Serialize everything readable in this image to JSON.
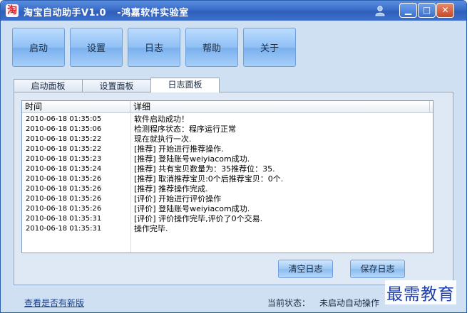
{
  "window": {
    "title": "淘宝自动助手V1.0   -鸿嘉软件实验室",
    "app_icon_glyph": "淘",
    "minimize_glyph": "▁",
    "maximize_glyph": "□",
    "close_glyph": "✕"
  },
  "toolbar": {
    "buttons": [
      {
        "label": "启动"
      },
      {
        "label": "设置"
      },
      {
        "label": "日志"
      },
      {
        "label": "帮助"
      },
      {
        "label": "关于"
      }
    ]
  },
  "tabs": [
    {
      "label": "启动面板",
      "active": false
    },
    {
      "label": "设置面板",
      "active": false
    },
    {
      "label": "日志面板",
      "active": true
    }
  ],
  "log": {
    "columns": [
      "时间",
      "详细"
    ],
    "rows": [
      {
        "time": "2010-06-18 01:35:05",
        "detail": "软件启动成功！"
      },
      {
        "time": "2010-06-18 01:35:06",
        "detail": "检测程序状态：程序运行正常"
      },
      {
        "time": "2010-06-18 01:35:22",
        "detail": "现在就执行一次."
      },
      {
        "time": "2010-06-18 01:35:22",
        "detail": "[推荐] 开始进行推荐操作."
      },
      {
        "time": "2010-06-18 01:35:23",
        "detail": "[推荐] 登陆账号weiyiacom成功."
      },
      {
        "time": "2010-06-18 01:35:24",
        "detail": "[推荐] 共有宝贝数量为：35推荐位：35."
      },
      {
        "time": "2010-06-18 01:35:26",
        "detail": "[推荐] 取消推荐宝贝:0个后推荐宝贝：0个."
      },
      {
        "time": "2010-06-18 01:35:26",
        "detail": "[推荐] 推荐操作完成."
      },
      {
        "time": "2010-06-18 01:35:26",
        "detail": "[评价] 开始进行评价操作"
      },
      {
        "time": "2010-06-18 01:35:26",
        "detail": "[评价] 登陆账号weiyiacom成功."
      },
      {
        "time": "2010-06-18 01:35:31",
        "detail": "[评价] 评价操作完毕,评价了0个交易."
      },
      {
        "time": "2010-06-18 01:35:31",
        "detail": "操作完毕."
      }
    ]
  },
  "actions": {
    "clear_label": "清空日志",
    "save_label": "保存日志"
  },
  "footer": {
    "update_link": "查看是否有新版",
    "status_label": "当前状态：",
    "status_value": "未启动自动操作"
  },
  "watermark": "最需教育",
  "colors": {
    "titlebar": "#3a6cc8",
    "window_bg": "#cfe0f3",
    "button_blue": "#8fc0f5",
    "link": "#1a3f8a",
    "watermark": "#1f3ea8"
  }
}
